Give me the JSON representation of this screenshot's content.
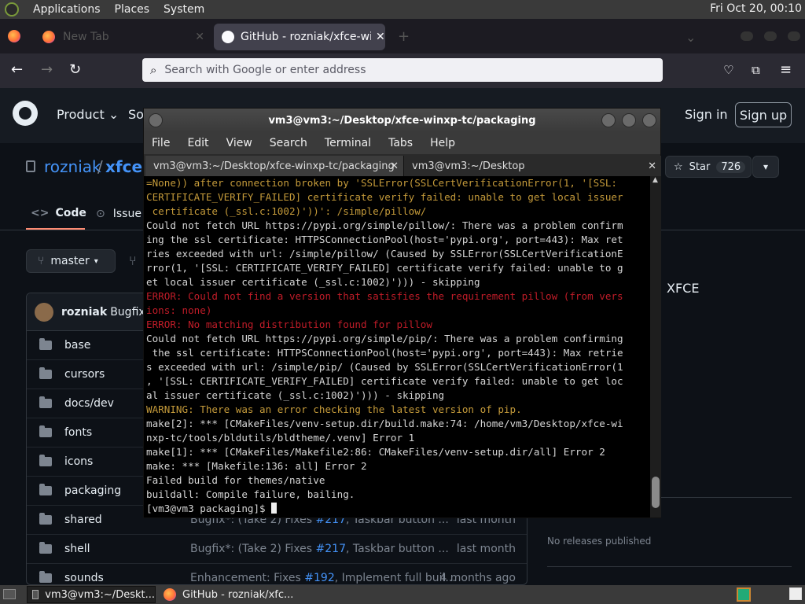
{
  "top_panel": {
    "menus": [
      "Applications",
      "Places",
      "System"
    ],
    "clock": "Fri Oct 20, 00:10"
  },
  "browser": {
    "tabs": [
      {
        "label": "New Tab"
      },
      {
        "label": "GitHub - rozniak/xfce-winxp-tc"
      }
    ],
    "url_placeholder": "Search with Google or enter address"
  },
  "github": {
    "nav": [
      "Product",
      "So"
    ],
    "sign_in": "Sign in",
    "sign_up": "Sign up",
    "repo_owner": "rozniak",
    "repo_sep": "/",
    "repo_name": "xfce-",
    "star_label": "Star",
    "star_count": "726",
    "tabs": [
      "Code",
      "Issue"
    ],
    "branch": "master",
    "about_text": "XFCE",
    "no_releases": "No releases published",
    "commit_author": "rozniak",
    "commit_msg": "Bugfix*:",
    "files": [
      {
        "name": "base",
        "msg": "",
        "msg_link": "",
        "msg_tail": "",
        "date": ""
      },
      {
        "name": "cursors",
        "msg": "",
        "msg_link": "",
        "msg_tail": "",
        "date": ""
      },
      {
        "name": "docs/dev",
        "msg": "",
        "msg_link": "",
        "msg_tail": "",
        "date": ""
      },
      {
        "name": "fonts",
        "msg": "",
        "msg_link": "",
        "msg_tail": "",
        "date": ""
      },
      {
        "name": "icons",
        "msg": "",
        "msg_link": "",
        "msg_tail": "",
        "date": ""
      },
      {
        "name": "packaging",
        "msg": "",
        "msg_link": "",
        "msg_tail": "",
        "date": ""
      },
      {
        "name": "shared",
        "msg": "Bugfix*: (Take 2) Fixes",
        "msg_link": "#217",
        "msg_tail": ", Taskbar button ...",
        "date": "last month"
      },
      {
        "name": "shell",
        "msg": "Bugfix*: (Take 2) Fixes",
        "msg_link": "#217",
        "msg_tail": ", Taskbar button ...",
        "date": "last month"
      },
      {
        "name": "sounds",
        "msg": "Enhancement: Fixes",
        "msg_link": "#192",
        "msg_tail": ", Implement full buil...",
        "date": "4 months ago"
      }
    ]
  },
  "terminal": {
    "title": "vm3@vm3:~/Desktop/xfce-winxp-tc/packaging",
    "menu": [
      "File",
      "Edit",
      "View",
      "Search",
      "Terminal",
      "Tabs",
      "Help"
    ],
    "tabs": [
      "vm3@vm3:~/Desktop/xfce-winxp-tc/packaging",
      "vm3@vm3:~/Desktop"
    ],
    "lines": [
      {
        "t": "=None)) after connection broken by 'SSLError(SSLCertVerificationError(1, '[SSL:",
        "c": "warn"
      },
      {
        "t": "CERTIFICATE_VERIFY_FAILED] certificate verify failed: unable to get local issuer",
        "c": "warn"
      },
      {
        "t": " certificate (_ssl.c:1002)'))': /simple/pillow/",
        "c": "warn"
      },
      {
        "t": "Could not fetch URL https://pypi.org/simple/pillow/: There was a problem confirm",
        "c": ""
      },
      {
        "t": "ing the ssl certificate: HTTPSConnectionPool(host='pypi.org', port=443): Max ret",
        "c": ""
      },
      {
        "t": "ries exceeded with url: /simple/pillow/ (Caused by SSLError(SSLCertVerificationE",
        "c": ""
      },
      {
        "t": "rror(1, '[SSL: CERTIFICATE_VERIFY_FAILED] certificate verify failed: unable to g",
        "c": ""
      },
      {
        "t": "et local issuer certificate (_ssl.c:1002)'))) - skipping",
        "c": ""
      },
      {
        "t": "ERROR: Could not find a version that satisfies the requirement pillow (from vers",
        "c": "err"
      },
      {
        "t": "ions: none)",
        "c": "err"
      },
      {
        "t": "ERROR: No matching distribution found for pillow",
        "c": "err"
      },
      {
        "t": "Could not fetch URL https://pypi.org/simple/pip/: There was a problem confirming",
        "c": ""
      },
      {
        "t": " the ssl certificate: HTTPSConnectionPool(host='pypi.org', port=443): Max retrie",
        "c": ""
      },
      {
        "t": "s exceeded with url: /simple/pip/ (Caused by SSLError(SSLCertVerificationError(1",
        "c": ""
      },
      {
        "t": ", '[SSL: CERTIFICATE_VERIFY_FAILED] certificate verify failed: unable to get loc",
        "c": ""
      },
      {
        "t": "al issuer certificate (_ssl.c:1002)'))) - skipping",
        "c": ""
      },
      {
        "t": "WARNING: There was an error checking the latest version of pip.",
        "c": "warn"
      },
      {
        "t": "make[2]: *** [CMakeFiles/venv-setup.dir/build.make:74: /home/vm3/Desktop/xfce-wi",
        "c": ""
      },
      {
        "t": "nxp-tc/tools/bldutils/bldtheme/.venv] Error 1",
        "c": ""
      },
      {
        "t": "make[1]: *** [CMakeFiles/Makefile2:86: CMakeFiles/venv-setup.dir/all] Error 2",
        "c": ""
      },
      {
        "t": "make: *** [Makefile:136: all] Error 2",
        "c": ""
      },
      {
        "t": "Failed build for themes/native",
        "c": ""
      },
      {
        "t": "buildall: Compile failure, bailing.",
        "c": ""
      }
    ],
    "prompt": "[vm3@vm3 packaging]$ "
  },
  "taskbar": {
    "tasks": [
      "vm3@vm3:~/Deskt...",
      "GitHub - rozniak/xfc..."
    ]
  }
}
